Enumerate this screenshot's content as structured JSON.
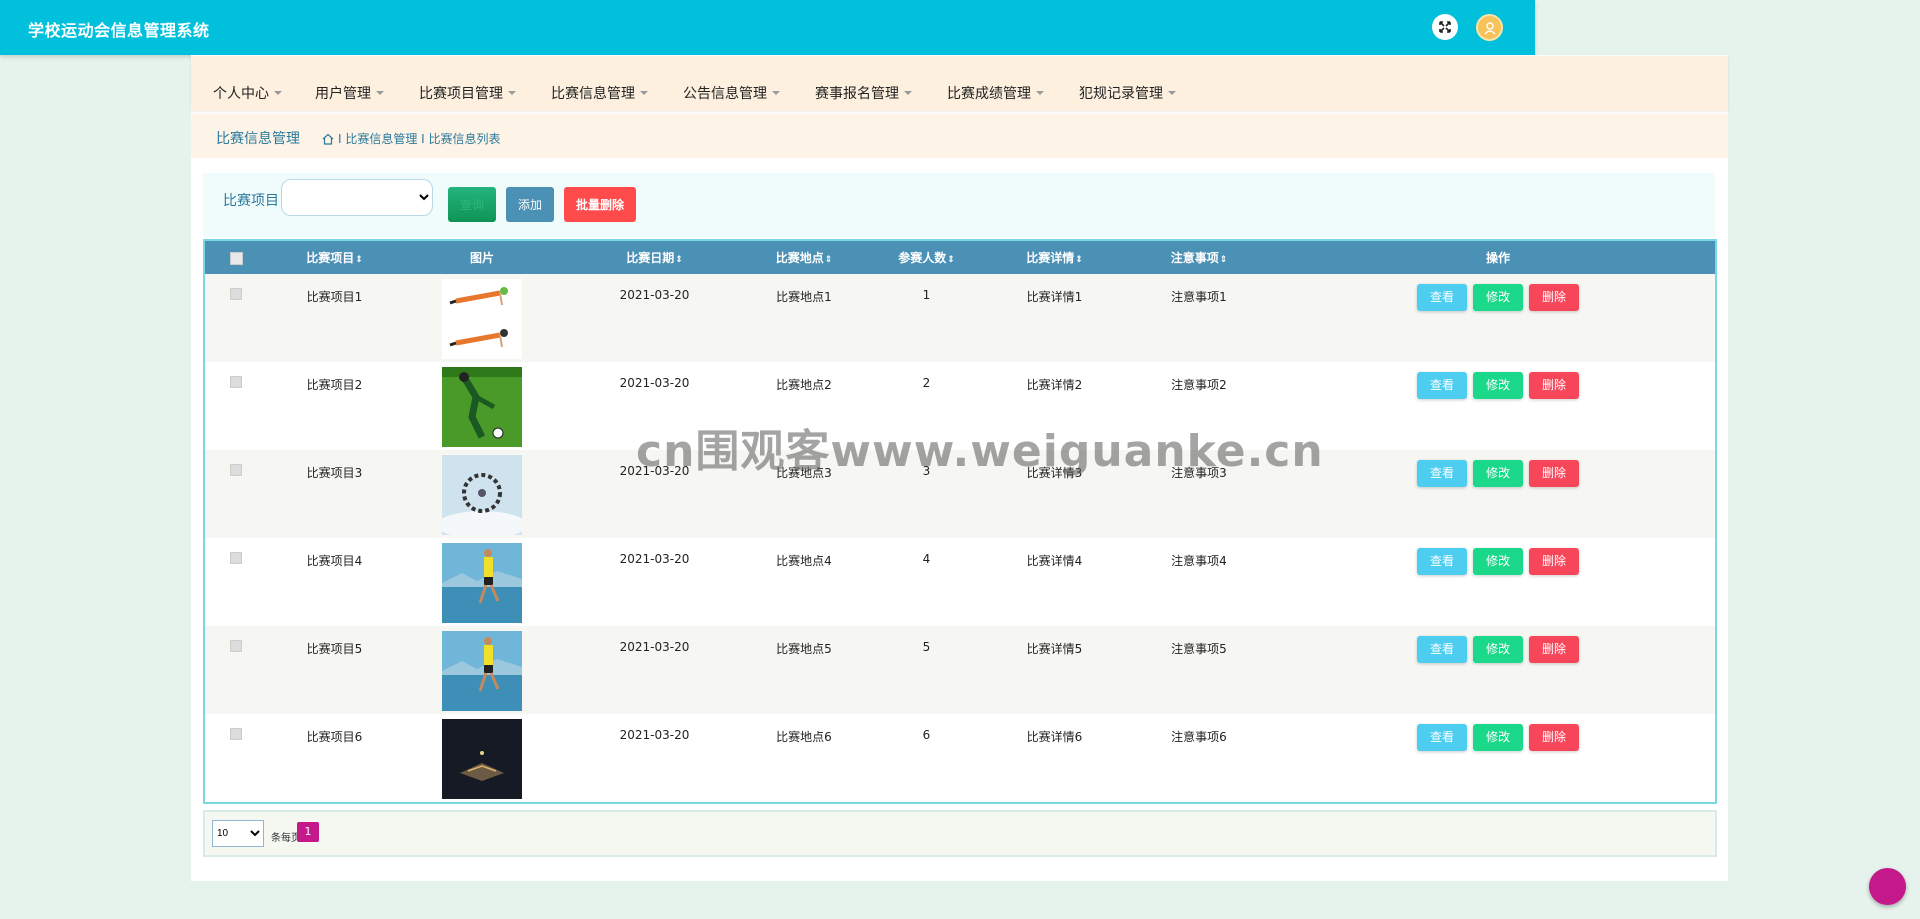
{
  "app": {
    "title": "学校运动会信息管理系统"
  },
  "nav": {
    "items": [
      {
        "label": "个人中心"
      },
      {
        "label": "用户管理"
      },
      {
        "label": "比赛项目管理"
      },
      {
        "label": "比赛信息管理"
      },
      {
        "label": "公告信息管理"
      },
      {
        "label": "赛事报名管理"
      },
      {
        "label": "比赛成绩管理"
      },
      {
        "label": "犯规记录管理"
      }
    ]
  },
  "breadcrumb": {
    "title": "比赛信息管理",
    "path": "I 比赛信息管理 I 比赛信息列表"
  },
  "search": {
    "label": "比赛项目",
    "select_value": "",
    "query_label": "查询",
    "add_label": "添加",
    "batch_delete_label": "批量删除"
  },
  "table": {
    "headers": [
      "比赛项目",
      "图片",
      "比赛日期",
      "比赛地点",
      "参赛人数",
      "比赛详情",
      "注意事项",
      "操作"
    ],
    "sort_icon": "⇕",
    "rows": [
      {
        "project": "比赛项目1",
        "image": "plank-exercise",
        "date": "2021-03-20",
        "place": "比赛地点1",
        "count": "1",
        "detail": "比赛详情1",
        "note": "注意事项1"
      },
      {
        "project": "比赛项目2",
        "image": "soccer-kick",
        "date": "2021-03-20",
        "place": "比赛地点2",
        "count": "2",
        "detail": "比赛详情2",
        "note": "注意事项2"
      },
      {
        "project": "比赛项目3",
        "image": "skydiving-formation",
        "date": "2021-03-20",
        "place": "比赛地点3",
        "count": "3",
        "detail": "比赛详情3",
        "note": "注意事项3"
      },
      {
        "project": "比赛项目4",
        "image": "runner-lake",
        "date": "2021-03-20",
        "place": "比赛地点4",
        "count": "4",
        "detail": "比赛详情4",
        "note": "注意事项4"
      },
      {
        "project": "比赛项目5",
        "image": "runner-lake",
        "date": "2021-03-20",
        "place": "比赛地点5",
        "count": "5",
        "detail": "比赛详情5",
        "note": "注意事项5"
      },
      {
        "project": "比赛项目6",
        "image": "night-stadium",
        "date": "2021-03-20",
        "place": "比赛地点6",
        "count": "6",
        "detail": "比赛详情6",
        "note": "注意事项6"
      }
    ],
    "actions": {
      "view": "查看",
      "edit": "修改",
      "delete": "删除"
    }
  },
  "pager": {
    "page_size": "10",
    "per_page_label": "条每页",
    "current_page": "1"
  },
  "watermark": "cn围观客www.weiguanke.cn",
  "colors": {
    "topbar": "#00c0dc",
    "table_header": "#4b90b5",
    "view": "#4dcdf0",
    "edit": "#1bd88a",
    "delete": "#f74659",
    "accent": "#c4198a"
  }
}
